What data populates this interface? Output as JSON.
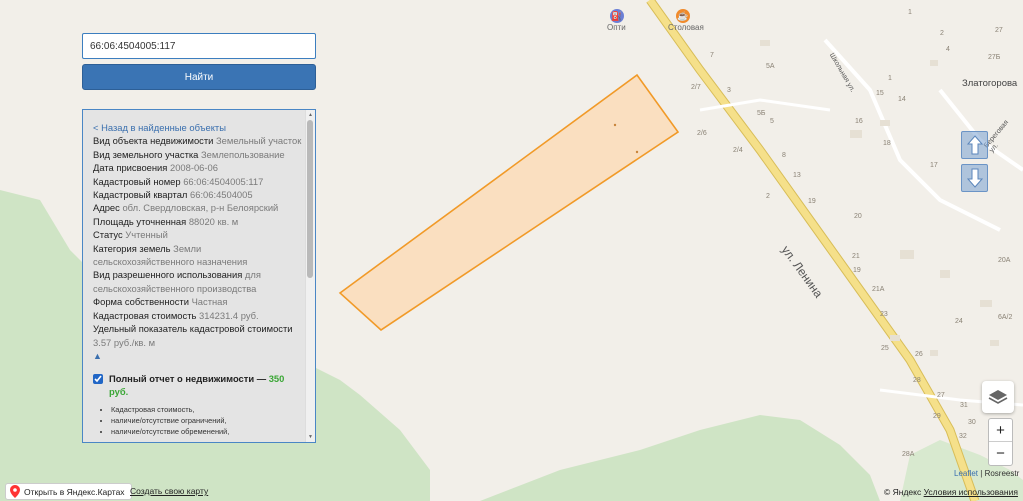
{
  "search": {
    "value": "66:06:4504005:117"
  },
  "find_button_label": "Найти",
  "info": {
    "back_link": "< Назад в найденные объекты",
    "rows": [
      {
        "label": "Вид объекта недвижимости",
        "value": "Земельный участок"
      },
      {
        "label": "Вид земельного участка",
        "value": "Землепользование"
      },
      {
        "label": "Дата присвоения",
        "value": "2008-06-06"
      },
      {
        "label": "Кадастровый номер",
        "value": "66:06:4504005:117"
      },
      {
        "label": "Кадастровый квартал",
        "value": "66:06:4504005"
      },
      {
        "label": "Адрес",
        "value": "обл. Свердловская, р-н Белоярский"
      },
      {
        "label": "Площадь уточненная",
        "value": "88020 кв. м"
      },
      {
        "label": "Статус",
        "value": "Учтенный"
      },
      {
        "label": "Категория земель",
        "value": "Земли сельскохозяйственного назначения"
      },
      {
        "label": "Вид разрешенного использования",
        "value": "для сельскохозяйственного производства"
      },
      {
        "label": "Форма собственности",
        "value": "Частная"
      },
      {
        "label": "Кадастровая стоимость",
        "value": "314231.4 руб."
      },
      {
        "label": "Удельный показатель кадастровой стоимости",
        "value": "3.57 руб./кв. м"
      }
    ],
    "collapse_arrow": "▲",
    "report": {
      "checked": true,
      "title": "Полный отчет о недвижимости — ",
      "price": "350 руб.",
      "items": [
        "Кадастровая стоимость,",
        "наличие/отсутствие ограничений,",
        "наличие/отсутствие обременений,"
      ]
    }
  },
  "map": {
    "street_main": "ул. Ленина",
    "street_side": "Школьная ул.",
    "street_side2": "Береговая ул.",
    "village": "Златогорова",
    "poi": [
      {
        "name": "Опти",
        "icon": "fuel-icon",
        "color": "#6b7fd6"
      },
      {
        "name": "Столовая",
        "icon": "cafe-icon",
        "color": "#f08a2b"
      }
    ],
    "house_numbers": [
      "27",
      "27Б",
      "1",
      "2",
      "3",
      "4",
      "5А",
      "5Б",
      "5",
      "7",
      "8",
      "2/7",
      "2/6",
      "2/4",
      "2",
      "1",
      "15",
      "14",
      "16",
      "18",
      "13",
      "17",
      "19",
      "20",
      "21",
      "19",
      "21А",
      "20А",
      "23",
      "24",
      "25",
      "26",
      "28",
      "27",
      "29",
      "30",
      "31",
      "32",
      "28А",
      "6А/2"
    ],
    "colors": {
      "plot_fill": "#fbdcb8",
      "plot_border": "#f19a28",
      "road": "#f5e08a",
      "road_border": "#d8bd58",
      "forest": "#cfe4c5",
      "land": "#f2efe9"
    }
  },
  "controls": {
    "zoom_in": "+",
    "zoom_out": "−",
    "layers_icon": "layers-icon"
  },
  "attribution": {
    "leaflet": "Leaflet",
    "sep": " | ",
    "rosreestr": "Rosreestr"
  },
  "bottom": {
    "open_yandex": "Открыть в Яндекс.Картах",
    "create_map": "Создать свою карту",
    "copyright": "© Яндекс",
    "terms": "Условия использования"
  }
}
